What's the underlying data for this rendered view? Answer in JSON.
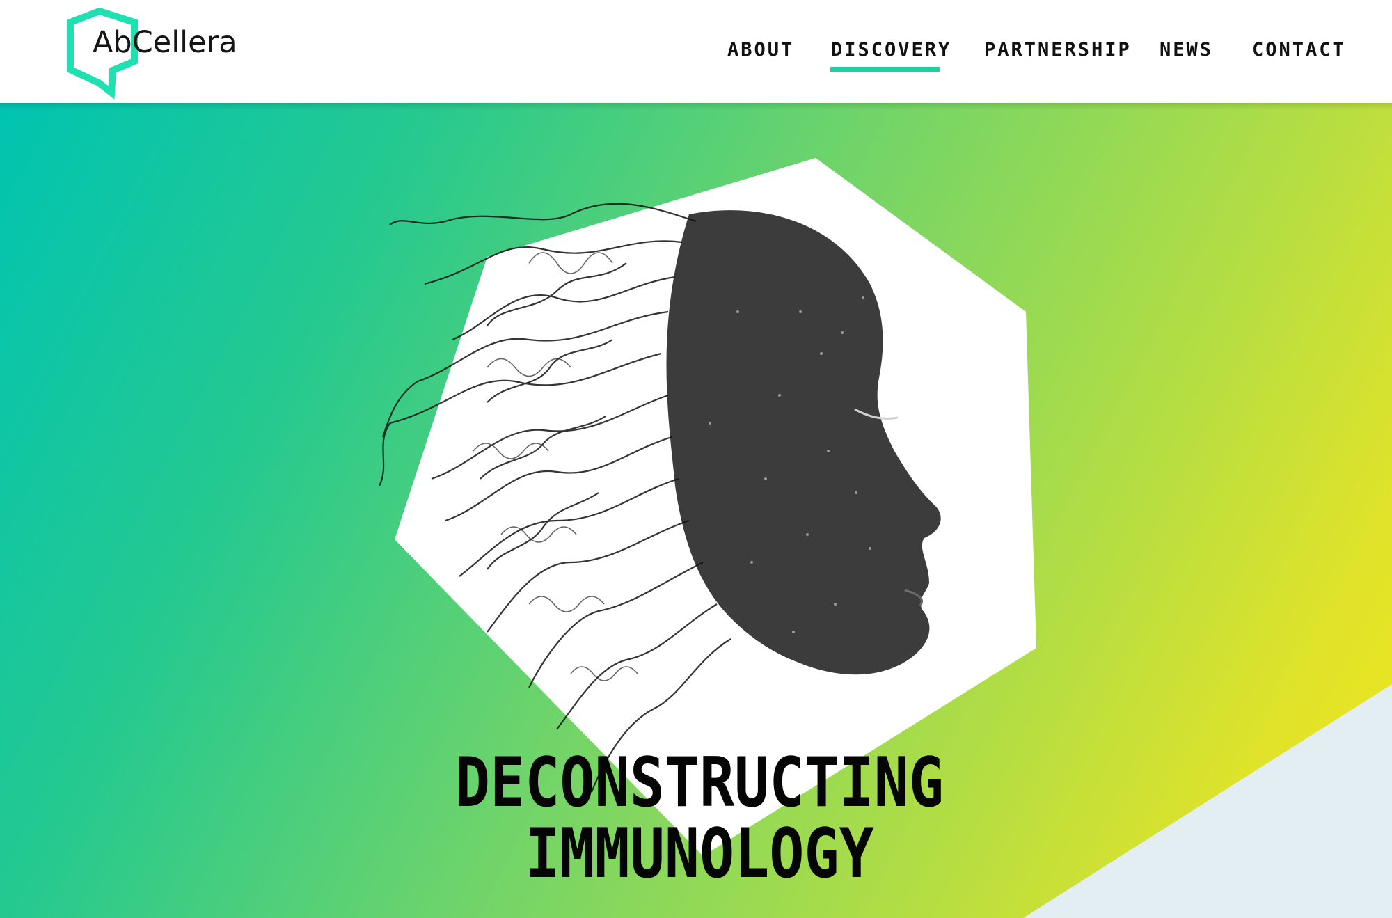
{
  "brand": {
    "name": "AbCellera",
    "accent_color": "#1fcf9e",
    "logo_icon": "hexagon-speech-logo-icon"
  },
  "nav": {
    "items": [
      {
        "label": "ABOUT",
        "active": false
      },
      {
        "label": "DISCOVERY",
        "active": true
      },
      {
        "label": "PARTNERSHIP",
        "active": false
      },
      {
        "label": "NEWS",
        "active": false
      },
      {
        "label": "CONTACT",
        "active": false
      }
    ],
    "active_underline_color": "#1fcf9e"
  },
  "hero": {
    "headline_line1": "DECONSTRUCTING",
    "headline_line2": "IMMUNOLOGY",
    "image": "face-profile-dissolving-into-lines",
    "gradient_colors": [
      "#00c4b1",
      "#6fd46a",
      "#f3e51c"
    ],
    "corner_panel_color": "#e3eef3"
  }
}
